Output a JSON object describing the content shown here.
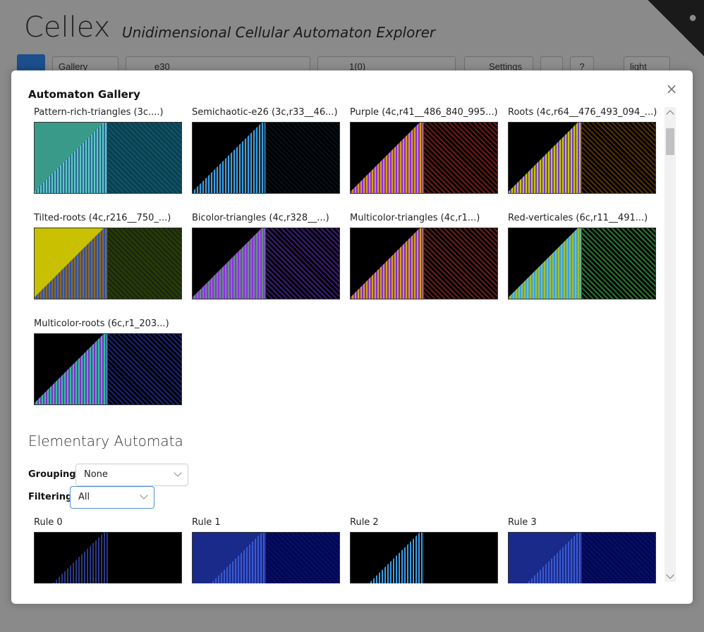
{
  "app": {
    "title": "Cellex",
    "subtitle": "Unidimensional Cellular Automaton Explorer",
    "gallery_btn": "Gallery",
    "rule_value": "e30",
    "init_value": "1(0)",
    "settings_btn": "Settings",
    "help_btn": "?",
    "theme_value": "light"
  },
  "modal": {
    "title": "Automaton Gallery",
    "close_label": "×"
  },
  "gallery": [
    {
      "label": "Pattern-rich-triangles (3c....)",
      "colors": [
        "#3a9a8a",
        "#5ec8c8",
        "#2b6a8c"
      ]
    },
    {
      "label": "Semichaotic-e26 (3c,r33__46...)",
      "colors": [
        "#000000",
        "#1a1a1a",
        "#3aa0e8"
      ]
    },
    {
      "label": "Purple (4c,r41__486_840_995...)",
      "colors": [
        "#000000",
        "#8a2be2",
        "#d4a017"
      ]
    },
    {
      "label": "Roots (4c,r64__476_493_094_...)",
      "colors": [
        "#000000",
        "#c8c800",
        "#7040c0"
      ]
    },
    {
      "label": "Tilted-roots (4c,r216__750_...)",
      "colors": [
        "#c8c000",
        "#8a6a2a",
        "#3050a0"
      ]
    },
    {
      "label": "Bicolor-triangles (4c,r328__...)",
      "colors": [
        "#000000",
        "#9030e0",
        "#6a8a8a"
      ]
    },
    {
      "label": "Multicolor-triangles (4c,r1...)",
      "colors": [
        "#000000",
        "#8030c0",
        "#d4a020"
      ]
    },
    {
      "label": "Red-verticales (6c,r11__491...)",
      "colors": [
        "#000000",
        "#3aa0e8",
        "#a0c030"
      ]
    },
    {
      "label": "Multicolor-roots (6c,r1_203...)",
      "colors": [
        "#000000",
        "#8030c0",
        "#30c0a0"
      ]
    }
  ],
  "elementary": {
    "heading": "Elementary Automata",
    "grouping_label": "Grouping",
    "grouping_value": "None",
    "filtering_label": "Filtering",
    "filtering_value": "All",
    "rules": [
      {
        "label": "Rule 0",
        "colors": [
          "#000000",
          "#000000",
          "#2a3a8a"
        ]
      },
      {
        "label": "Rule 1",
        "colors": [
          "#1a2a8a",
          "#3a5ad0",
          "#1a2a8a"
        ]
      },
      {
        "label": "Rule 2",
        "colors": [
          "#000000",
          "#3aa0e8",
          "#000000"
        ]
      },
      {
        "label": "Rule 3",
        "colors": [
          "#1a2a8a",
          "#3a5ad0",
          "#1a2a8a"
        ]
      }
    ]
  }
}
